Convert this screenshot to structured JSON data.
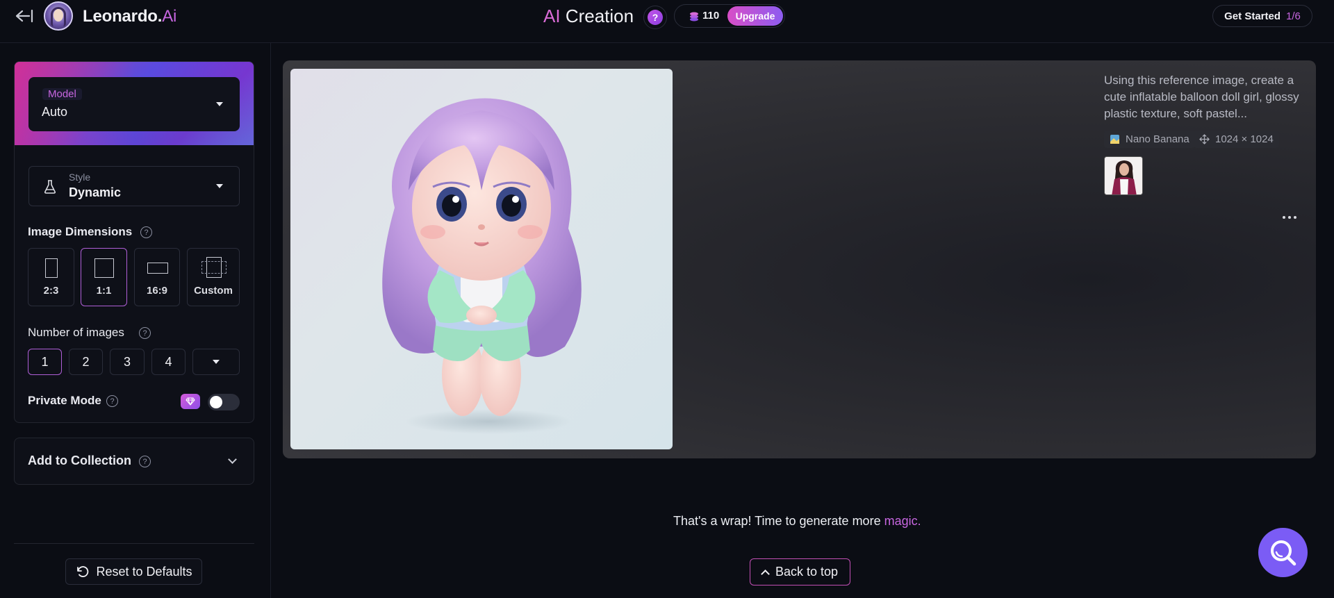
{
  "header": {
    "brand_name": "Leonardo.",
    "brand_suffix": "Ai",
    "title_prefix": "AI",
    "title_main": "Creation",
    "help_glyph": "?",
    "credits": "110",
    "upgrade_label": "Upgrade",
    "get_started_label": "Get Started",
    "get_started_progress": "1/6"
  },
  "settings": {
    "model_label": "Model",
    "model_value": "Auto",
    "style_label": "Style",
    "style_value": "Dynamic",
    "dimensions_label": "Image Dimensions",
    "dimensions": [
      {
        "label": "2:3",
        "active": false
      },
      {
        "label": "1:1",
        "active": true
      },
      {
        "label": "16:9",
        "active": false
      },
      {
        "label": "Custom",
        "active": false
      }
    ],
    "num_images_label": "Number of images",
    "num_images": [
      "1",
      "2",
      "3",
      "4"
    ],
    "num_images_selected": "1",
    "private_mode_label": "Private Mode",
    "private_mode_on": false,
    "collection_label": "Add to Collection",
    "reset_label": "Reset to Defaults"
  },
  "generation": {
    "prompt": "Using this reference image, create a cute inflatable balloon doll girl, glossy plastic texture, soft pastel...",
    "model_tag": "Nano Banana",
    "size_tag": "1024 × 1024"
  },
  "footer": {
    "wrap_text": "That's a wrap! Time to generate more ",
    "wrap_link": "magic.",
    "back_to_top_label": "Back to top"
  },
  "icons": {
    "back": "arrow-left-bar-icon",
    "coins": "coins-icon",
    "flask": "flask-icon",
    "gem": "gem-icon",
    "reset": "rotate-ccw-icon",
    "search": "search-icon"
  },
  "colors": {
    "accent": "#c766e0",
    "fab": "#7b5cf5",
    "background": "#0b0d14"
  }
}
